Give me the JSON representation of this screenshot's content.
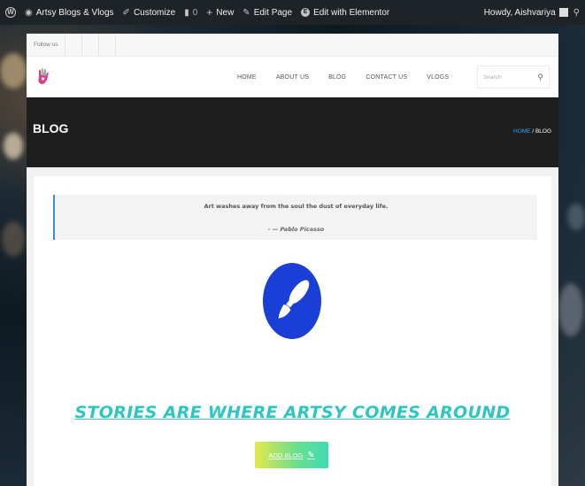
{
  "adminbar": {
    "site_name": "Artsy Blogs & Vlogs",
    "customize": "Customize",
    "comments_count": "0",
    "new": "New",
    "edit_page": "Edit Page",
    "edit_elementor": "Edit with Elementor",
    "howdy": "Howdy, Aishvariya"
  },
  "topbar": {
    "follow": "Follow us"
  },
  "nav": {
    "items": [
      "HOME",
      "ABOUT US",
      "BLOG",
      "CONTACT US",
      "VLOGS"
    ],
    "search_placeholder": "Search"
  },
  "page": {
    "title": "BLOG",
    "breadcrumb_home": "HOME",
    "breadcrumb_sep": " / ",
    "breadcrumb_current": "BLOG"
  },
  "quote": {
    "text": "Art washes away from the soul the dust of everyday life.",
    "author": "- — Pablo Picasso"
  },
  "hero": {
    "tagline": "STORIES ARE WHERE ARTSY COMES AROUND",
    "button": "ADD BLOG"
  },
  "colors": {
    "adminbar": "#1d2327",
    "accent_blue": "#1a3fd6",
    "tagline": "#2ec6c0",
    "breadcrumb_home": "#2aa7ff"
  },
  "icons": [
    "wordpress-icon",
    "dashboard-icon",
    "brush-icon",
    "comment-icon",
    "plus-icon",
    "pencil-icon",
    "elementor-icon",
    "search-icon",
    "paintbrush-icon"
  ]
}
